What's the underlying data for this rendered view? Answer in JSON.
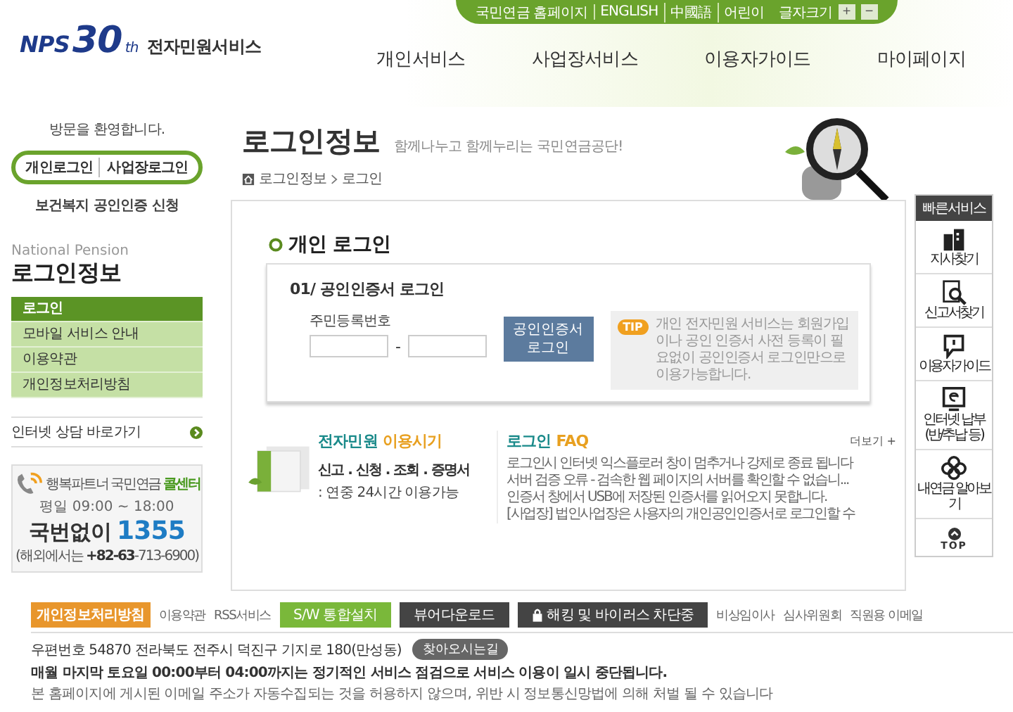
{
  "top_bar": {
    "links": [
      "국민연금 홈페이지",
      "ENGLISH",
      "中國語",
      "어린이"
    ],
    "font_size_label": "글자크기",
    "font_size_buttons": [
      "+",
      "−"
    ]
  },
  "logo": {
    "brand": "NPS",
    "anniversary": "30",
    "suffix": "th",
    "service": "전자민원서비스"
  },
  "main_nav": [
    "개인서비스",
    "사업장서비스",
    "이용자가이드",
    "마이페이지"
  ],
  "sidebar": {
    "welcome": "방문을 환영합니다.",
    "login_links": [
      "개인로그인",
      "사업장로그인"
    ],
    "cert_link": "보건복지 공인인증 신청",
    "section_en": "National Pension",
    "section_title": "로그인정보",
    "menu": [
      {
        "label": "로그인",
        "selected": true
      },
      {
        "label": "모바일 서비스 안내",
        "selected": false
      },
      {
        "label": "이용약관",
        "selected": false
      },
      {
        "label": "개인정보처리방침",
        "selected": false
      }
    ],
    "consult_link": "인터넷 상담 바로가기",
    "call_center": {
      "title": "행복파트너 국민연금 **콜센터**",
      "hours": "평일 09:00 ~ 18:00",
      "number_label": "국번없이",
      "number": "1355",
      "overseas": "(해외에서는 **+82-63**-713-6900)"
    }
  },
  "page": {
    "title": "로그인정보",
    "slogan": "함께나누고 함께누리는 국민연금공단!",
    "breadcrumb": [
      "로그인정보",
      "로그인"
    ]
  },
  "login": {
    "heading": "개인 로그인",
    "method": "01/ 공인인증서 로그인",
    "field_label": "주민등록번호",
    "separator": "-",
    "button": "공인인증서 로그인",
    "tip_badge": "TIP",
    "tip": "개인 전자민원 서비스는 회원가입이나 공인 인증서 사전 등록이 필요없이 공인인증서 로그인만으로 이용가능합니다."
  },
  "guide": {
    "title": "전자민원",
    "title_accent": "이용시기",
    "line1": "신고 . 신청 . 조회 . 증명서",
    "line2": ": 연중 24시간 이용가능"
  },
  "faq": {
    "title": "로그인",
    "title_accent": "FAQ",
    "more": "더보기 +",
    "items": [
      "로그인시 인터넷 익스플로러 창이 멈추거나 강제로 종료 됩니다",
      "서버 검증 오류 - 검속한 웹 페이지의 서버를 확인할 수 없습니...",
      "인증서 창에서 USB에 저장된 인증서를 읽어오지 못합니다.",
      "[사업장] 법인사업장은 사용자의 개인공인인증서로 로그인할 수"
    ]
  },
  "quick": {
    "title": "빠른서비스",
    "items": [
      {
        "kind": "building",
        "label": "지사찾기"
      },
      {
        "kind": "document",
        "label": "신고서찾기"
      },
      {
        "kind": "chat",
        "label": "이용자가이드"
      },
      {
        "kind": "monitor",
        "label": "인터넷 납부 (반/추납 등)"
      },
      {
        "kind": "clover",
        "label": "내연금 알아보기"
      }
    ],
    "top": "TOP"
  },
  "footer": {
    "links": [
      {
        "label": "개인정보처리방침",
        "kind": "orange"
      },
      {
        "label": "이용약관",
        "kind": "plain"
      },
      {
        "label": "RSS서비스",
        "kind": "plain"
      },
      {
        "label": "S/W 통합설치",
        "kind": "green"
      },
      {
        "label": "뷰어다운로드",
        "kind": "dark"
      },
      {
        "label": "해킹 및 바이러스 차단중",
        "kind": "lock"
      },
      {
        "label": "비상임이사",
        "kind": "plain"
      },
      {
        "label": "심사위원회",
        "kind": "plain"
      },
      {
        "label": "직원용 이메일",
        "kind": "plain"
      }
    ],
    "address": "우편번호 54870  전라북도 전주시 덕진구 기지로 180(만성동)",
    "directions": "찾아오시는길",
    "notice": "매월 마지막 토요일 00:00부터 04:00까지는 정기적인 서비스 점검으로  서비스 이용이 일시 중단됩니다.",
    "policy": "본 홈페이지에 게시된 이메일 주소가 자동수집되는 것을 허용하지 않으며, 위반 시 정보통신망법에 의해 처벌 될 수 있습니다"
  }
}
